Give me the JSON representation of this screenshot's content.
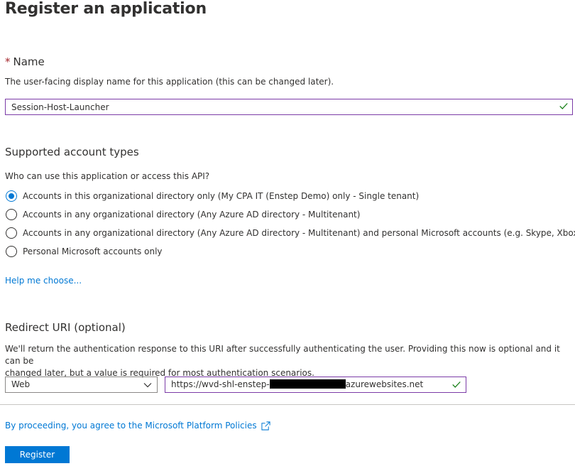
{
  "page": {
    "title": "Register an application"
  },
  "name_section": {
    "required_marker": "*",
    "title": "Name",
    "description": "The user-facing display name for this application (this can be changed later).",
    "value": "Session-Host-Launcher"
  },
  "account_types": {
    "title": "Supported account types",
    "question": "Who can use this application or access this API?",
    "options": [
      {
        "label": "Accounts in this organizational directory only (My CPA IT (Enstep Demo) only - Single tenant)",
        "selected": true
      },
      {
        "label": "Accounts in any organizational directory (Any Azure AD directory - Multitenant)",
        "selected": false
      },
      {
        "label": "Accounts in any organizational directory (Any Azure AD directory - Multitenant) and personal Microsoft accounts (e.g. Skype, Xbox)",
        "selected": false
      },
      {
        "label": "Personal Microsoft accounts only",
        "selected": false
      }
    ],
    "help_link": "Help me choose..."
  },
  "redirect": {
    "title": "Redirect URI (optional)",
    "description_line1": "We'll return the authentication response to this URI after successfully authenticating the user. Providing this now is optional and it can be",
    "description_line2": "changed later, but a value is required for most authentication scenarios.",
    "platform_value": "Web",
    "uri_prefix": "https://wvd-shl-enstep-",
    "uri_suffix": "azurewebsites.net"
  },
  "footer": {
    "policy_link": "By proceeding, you agree to the Microsoft Platform Policies",
    "register_label": "Register"
  },
  "colors": {
    "accent": "#0078d4",
    "input_border_active": "#7b3ba7",
    "valid_check": "#107c10",
    "required": "#a4262c"
  },
  "icons": {
    "valid": "checkmark-icon",
    "dropdown": "chevron-down-icon",
    "external": "external-link-icon"
  }
}
